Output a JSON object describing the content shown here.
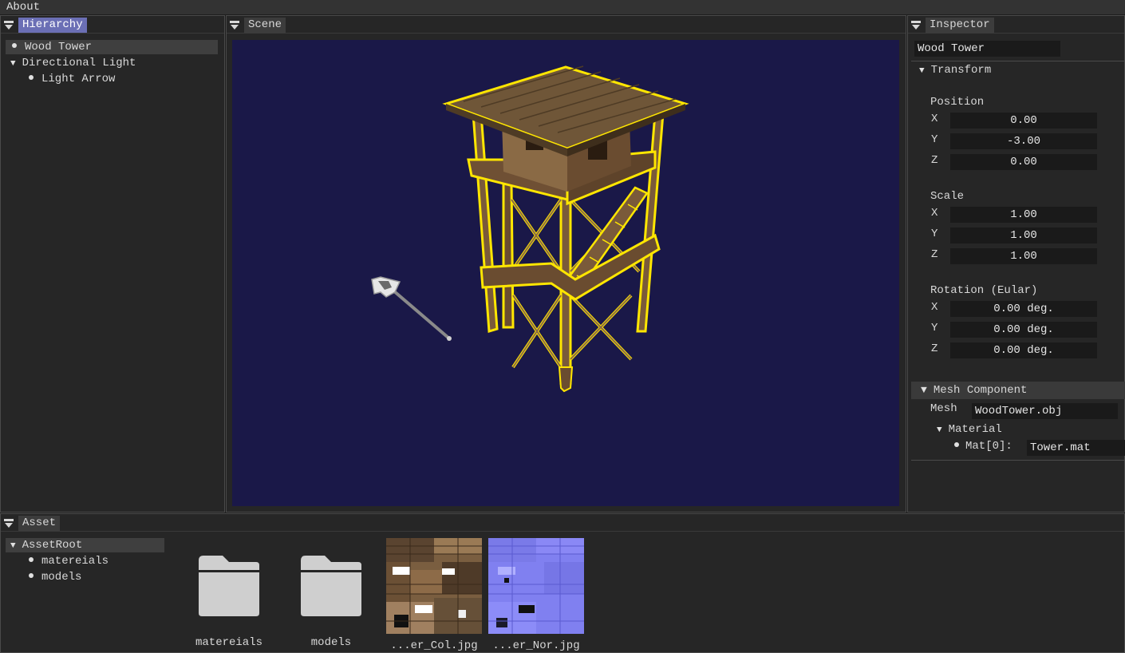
{
  "menubar": {
    "about": "About"
  },
  "hierarchy": {
    "tab": "Hierarchy",
    "items": [
      {
        "label": "Wood Tower"
      },
      {
        "label": "Directional Light"
      },
      {
        "label": "Light Arrow"
      }
    ]
  },
  "scene": {
    "tab": "Scene"
  },
  "inspector": {
    "tab": "Inspector",
    "name": "Wood Tower",
    "transform_label": "Transform",
    "position": {
      "label": "Position",
      "x_label": "X",
      "y_label": "Y",
      "z_label": "Z",
      "x": "0.00",
      "y": "-3.00",
      "z": "0.00"
    },
    "scale": {
      "label": "Scale",
      "x_label": "X",
      "y_label": "Y",
      "z_label": "Z",
      "x": "1.00",
      "y": "1.00",
      "z": "1.00"
    },
    "rotation": {
      "label": "Rotation (Eular)",
      "x_label": "X",
      "y_label": "Y",
      "z_label": "Z",
      "x": "0.00 deg.",
      "y": "0.00 deg.",
      "z": "0.00 deg."
    },
    "mesh_component": {
      "label": "Mesh Component",
      "mesh_label": "Mesh",
      "mesh_value": "WoodTower.obj",
      "material_label": "Material",
      "mat0_label": "Mat[0]:",
      "mat0_value": "Tower.mat"
    }
  },
  "asset": {
    "tab": "Asset",
    "tree": [
      {
        "label": "AssetRoot"
      },
      {
        "label": "matereials"
      },
      {
        "label": "models"
      }
    ],
    "files": [
      {
        "label": "matereials",
        "icon": "folder-icon"
      },
      {
        "label": "models",
        "icon": "folder-icon"
      },
      {
        "label": "...er_Col.jpg",
        "icon": "color-texture-thumbnail"
      },
      {
        "label": "...er_Nor.jpg",
        "icon": "normal-texture-thumbnail"
      }
    ]
  },
  "colors": {
    "active_tab": "#6b6fb5",
    "scene_background": "#1a1848",
    "selection_outline": "#ffe600"
  }
}
